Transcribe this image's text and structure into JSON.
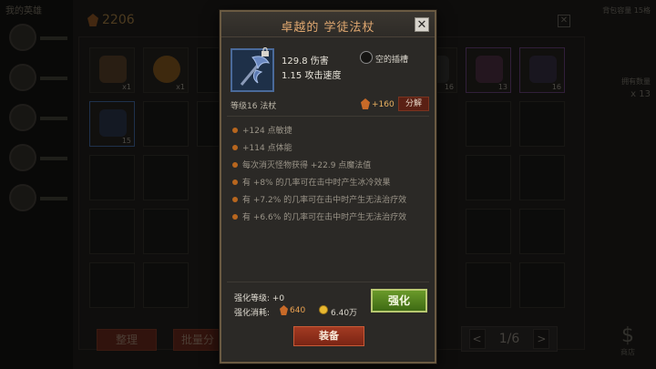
{
  "background": {
    "header_text": "我的英雄",
    "gold_amount": "2206",
    "slots": [
      {
        "label": "x1",
        "color": "#6a4a2a"
      },
      {
        "label": "x1",
        "color": "#a86a1a"
      },
      {
        "label": "16",
        "color": "#3a3a3a"
      },
      {
        "label": "13",
        "color": "#5a3050"
      },
      {
        "label": "16",
        "color": "#3a3050"
      },
      {
        "label": "15",
        "color": "#2a3a5a"
      }
    ],
    "sort_button": "整理",
    "batch_button": "批量分",
    "page": "1/6",
    "prev": "<",
    "next": ">",
    "right_top": "背包容量 15格",
    "right_mid": "拥有数量",
    "right_count": "x 13",
    "right_shop": "商店",
    "dollar_icon": "$"
  },
  "modal": {
    "title": "卓越的 学徒法杖",
    "close": "✕",
    "item": {
      "damage": "129.8 伤害",
      "attack_speed": "1.15 攻击速度",
      "socket": "空的插槽",
      "level_type": "等级16  法杖",
      "sell_value": "+160",
      "salvage_button": "分解"
    },
    "affixes": [
      "+124 点敏捷",
      "+114 点体能",
      "每次消灭怪物获得 +22.9 点魔法值",
      "有 +8% 的几率可在击中时产生冰冷效果",
      "有 +7.2% 的几率可在击中时产生无法治疗效",
      "有 +6.6% 的几率可在击中时产生无法治疗效"
    ],
    "enhance": {
      "level_label": "强化等级:  +0",
      "cost_label": "强化消耗:",
      "gem_cost": "640",
      "gold_cost": "6.40万",
      "button": "强化"
    },
    "equip_button": "装备"
  },
  "colors": {
    "accent_orange": "#e0a870",
    "enhance_green": "#6a9a2a",
    "equip_red": "#a23a22",
    "affix_bullet": "#b8661e"
  }
}
